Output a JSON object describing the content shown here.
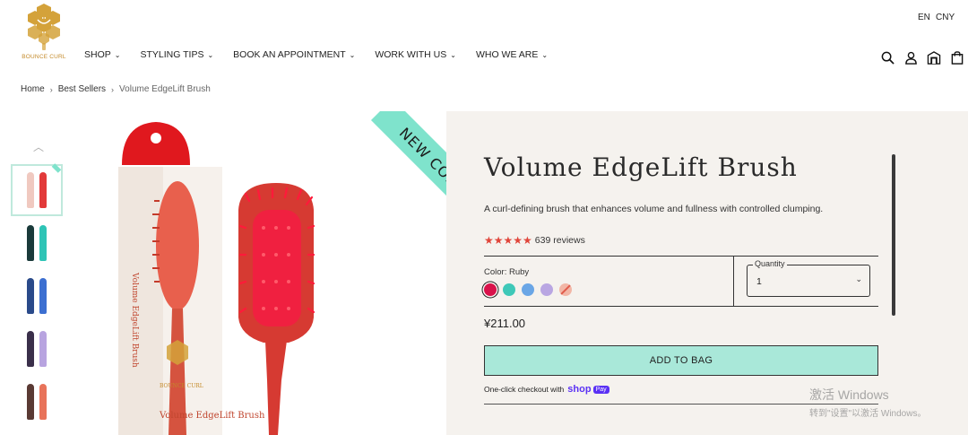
{
  "header": {
    "logo_text": "BOUNCE CURL",
    "lang": "EN",
    "currency": "CNY",
    "nav": [
      {
        "label": "SHOP"
      },
      {
        "label": "STYLING TIPS"
      },
      {
        "label": "BOOK AN APPOINTMENT"
      },
      {
        "label": "WORK WITH US"
      },
      {
        "label": "WHO WE ARE"
      }
    ],
    "icons": [
      "search-icon",
      "account-icon",
      "store-icon",
      "bag-icon"
    ]
  },
  "breadcrumb": {
    "home": "Home",
    "category": "Best Sellers",
    "current": "Volume EdgeLift Brush"
  },
  "gallery": {
    "ribbon": "NEW COLOR!",
    "box_text": "Volume EdgeLift Brush",
    "box_brand": "BOUNCE CURL",
    "box_front": "Volume EdgeLift Brush",
    "thumbnails": [
      {
        "name": "ruby",
        "color": "#e23a3a"
      },
      {
        "name": "teal",
        "color": "#2ec4b6"
      },
      {
        "name": "blue",
        "color": "#3c6fd1"
      },
      {
        "name": "lavender",
        "color": "#7a62b0"
      },
      {
        "name": "coral",
        "color": "#e8735a"
      }
    ]
  },
  "product": {
    "title": "Volume EdgeLift Brush",
    "description": "A curl-defining brush that enhances volume and fullness with controlled clumping.",
    "stars": "★★★★★",
    "rating": 5,
    "reviews": "639 reviews",
    "color_label": "Color: Ruby",
    "swatches": [
      {
        "name": "ruby",
        "color": "#d9114a",
        "selected": true
      },
      {
        "name": "teal",
        "color": "#3ec8b8"
      },
      {
        "name": "blue",
        "color": "#6aa6e6"
      },
      {
        "name": "lavender",
        "color": "#b9a6e2"
      },
      {
        "name": "coral",
        "color": "#f2b6a6"
      }
    ],
    "quantity_label": "Quantity",
    "quantity_value": "1",
    "price": "¥211.00",
    "add_to_bag": "ADD TO BAG",
    "oneclick": "One-click checkout with",
    "shop_word": "shop",
    "pay_badge": "Pay"
  },
  "watermark": {
    "line1": "激活 Windows",
    "line2": "转到\"设置\"以激活 Windows。"
  },
  "colors": {
    "accent": "#a9e8d9",
    "ribbon": "#7fe3cc",
    "panel_bg": "#f5f2ee",
    "star": "#e0453a"
  }
}
